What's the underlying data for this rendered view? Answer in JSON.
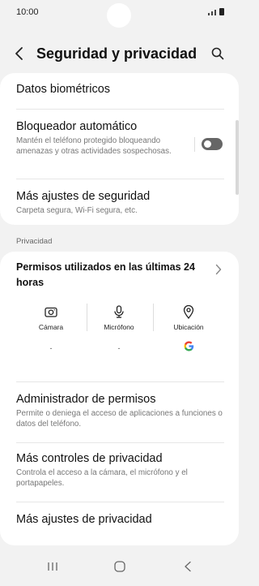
{
  "status_bar": {
    "time": "10:00"
  },
  "header": {
    "title": "Seguridad y privacidad"
  },
  "security_card": {
    "biometrics_label": "Datos biométricos",
    "auto_blocker": {
      "title": "Bloqueador automático",
      "subtitle": "Mantén el teléfono protegido bloqueando amenazas y otras actividades sospechosas.",
      "enabled": false
    },
    "more_security": {
      "title": "Más ajustes de seguridad",
      "subtitle": "Carpeta segura, Wi-Fi segura, etc."
    }
  },
  "privacy_section": {
    "label": "Privacidad",
    "permissions_used": {
      "title": "Permisos utilizados en las últimas 24 horas",
      "items": [
        {
          "label": "Cámara",
          "value": "-",
          "icon": "camera-icon"
        },
        {
          "label": "Micrófono",
          "value": "-",
          "icon": "microphone-icon"
        },
        {
          "label": "Ubicación",
          "icon": "location-icon",
          "app_icon": "google-g-icon"
        }
      ]
    },
    "permission_manager": {
      "title": "Administrador de permisos",
      "subtitle": "Permite o deniega el acceso de aplicaciones a funciones o datos del teléfono."
    },
    "more_privacy_controls": {
      "title": "Más controles de privacidad",
      "subtitle": "Controla el acceso a la cámara, el micrófono y el portapapeles."
    },
    "more_privacy_settings": {
      "title": "Más ajustes de privacidad"
    }
  },
  "colors": {
    "toggle_off": "#666666",
    "google_blue": "#4285F4",
    "google_red": "#EA4335",
    "google_yellow": "#FBBC05",
    "google_green": "#34A853"
  }
}
